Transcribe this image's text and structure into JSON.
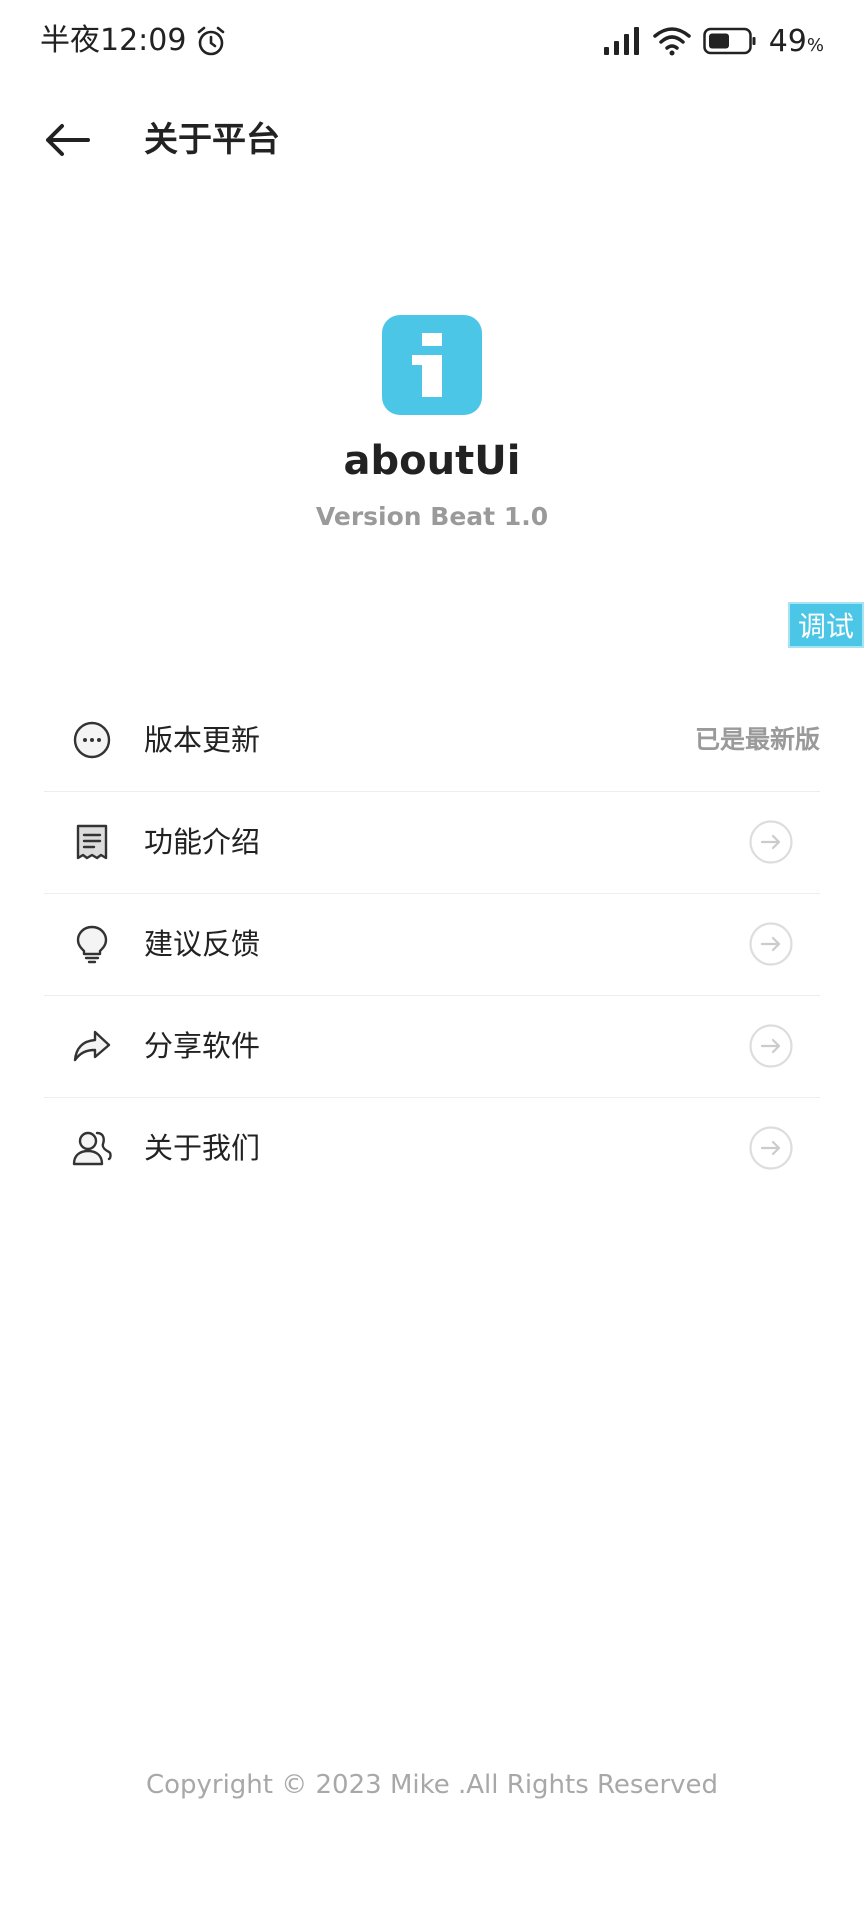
{
  "status_bar": {
    "time": "半夜12:09",
    "battery_percent": "49",
    "percent_sign": "%",
    "icons": [
      "alarm-icon",
      "signal-icon",
      "wifi-icon",
      "battery-icon"
    ]
  },
  "header": {
    "back_icon": "arrow-left-icon",
    "title": "关于平台"
  },
  "app": {
    "logo_icon": "info-icon",
    "logo_color": "#4cc6e6",
    "name": "aboutUi",
    "version": "Version Beat 1.0"
  },
  "debug_tag": {
    "label": "调试",
    "color": "#4cc6e6"
  },
  "menu": {
    "items": [
      {
        "label": "版本更新",
        "icon": "more-circle-icon",
        "value": "已是最新版"
      },
      {
        "label": "功能介绍",
        "icon": "document-icon",
        "value": ""
      },
      {
        "label": "建议反馈",
        "icon": "lightbulb-icon",
        "value": ""
      },
      {
        "label": "分享软件",
        "icon": "share-icon",
        "value": ""
      },
      {
        "label": "关于我们",
        "icon": "users-icon",
        "value": ""
      }
    ]
  },
  "footer": {
    "copyright": "Copyright © 2023 Mike .All Rights Reserved"
  }
}
